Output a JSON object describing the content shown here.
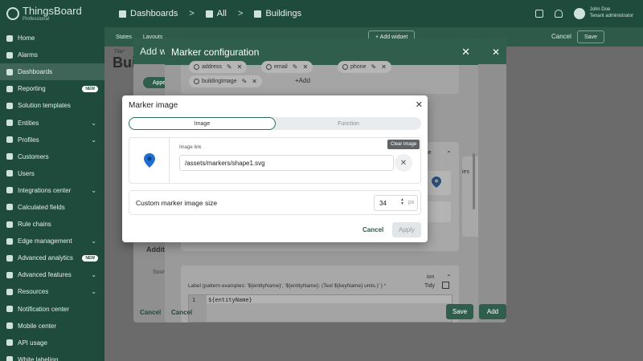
{
  "brand": {
    "name": "ThingsBoard",
    "edition": "Professional"
  },
  "sidebar": {
    "items": [
      {
        "label": "Home"
      },
      {
        "label": "Alarms"
      },
      {
        "label": "Dashboards"
      },
      {
        "label": "Reporting",
        "badge": "NEW"
      },
      {
        "label": "Solution templates"
      },
      {
        "label": "Entities",
        "chevron": true
      },
      {
        "label": "Profiles",
        "chevron": true
      },
      {
        "label": "Customers"
      },
      {
        "label": "Users"
      },
      {
        "label": "Integrations center",
        "chevron": true
      },
      {
        "label": "Calculated fields"
      },
      {
        "label": "Rule chains"
      },
      {
        "label": "Edge management",
        "chevron": true
      },
      {
        "label": "Advanced analytics",
        "badge": "NEW"
      },
      {
        "label": "Advanced features",
        "chevron": true
      },
      {
        "label": "Resources",
        "chevron": true
      },
      {
        "label": "Notification center"
      },
      {
        "label": "Mobile center"
      },
      {
        "label": "API usage"
      },
      {
        "label": "White labeling"
      }
    ]
  },
  "topbar": {
    "breadcrumbs": [
      "Dashboards",
      "All",
      "Buildings"
    ],
    "user_name": "John Doe",
    "user_role": "Tenant administrator"
  },
  "dash_toolbar": {
    "states": "States",
    "layouts": "Layouts",
    "add_widget": "+ Add widget",
    "cancel": "Cancel",
    "save": "Save"
  },
  "background": {
    "title_small": "Title*",
    "title": "Buil"
  },
  "add_widget_dialog": {
    "title": "Add w",
    "pill": "Appe",
    "additional": "Additi",
    "source_label": "Sour",
    "cancel": "Cancel",
    "add": "Add"
  },
  "marker_config": {
    "title": "Marker configuration",
    "chips": [
      {
        "label": "address"
      },
      {
        "label": "email"
      },
      {
        "label": "phone"
      },
      {
        "label": "buildingImage"
      }
    ],
    "chip_add": "+Add",
    "label_hint": "Label (pattern examples: '${entityName}', '${entityName}: (Text ${keyName} units.)' ) *",
    "tidy": "Tidy",
    "editor_line_no": "1",
    "editor_code": "${entityName}",
    "partial_image": "age",
    "partial_ies": "ies",
    "partial_ion": "ion",
    "cancel": "Cancel",
    "save": "Save"
  },
  "marker_image": {
    "title": "Marker image",
    "tabs": [
      "Image",
      "Function"
    ],
    "selected_tab": "Image",
    "image_link_label": "Image link",
    "image_link_value": "/assets/markers/shape1.svg",
    "clear_tooltip": "Clear image",
    "size_label": "Custom marker image size",
    "size_value": "34",
    "size_unit": "px",
    "cancel": "Cancel",
    "apply": "Apply"
  },
  "colors": {
    "primary": "#2f6e57",
    "marker_blue": "#1e6fd0",
    "sidebar_bg": "#1e4b3b"
  }
}
